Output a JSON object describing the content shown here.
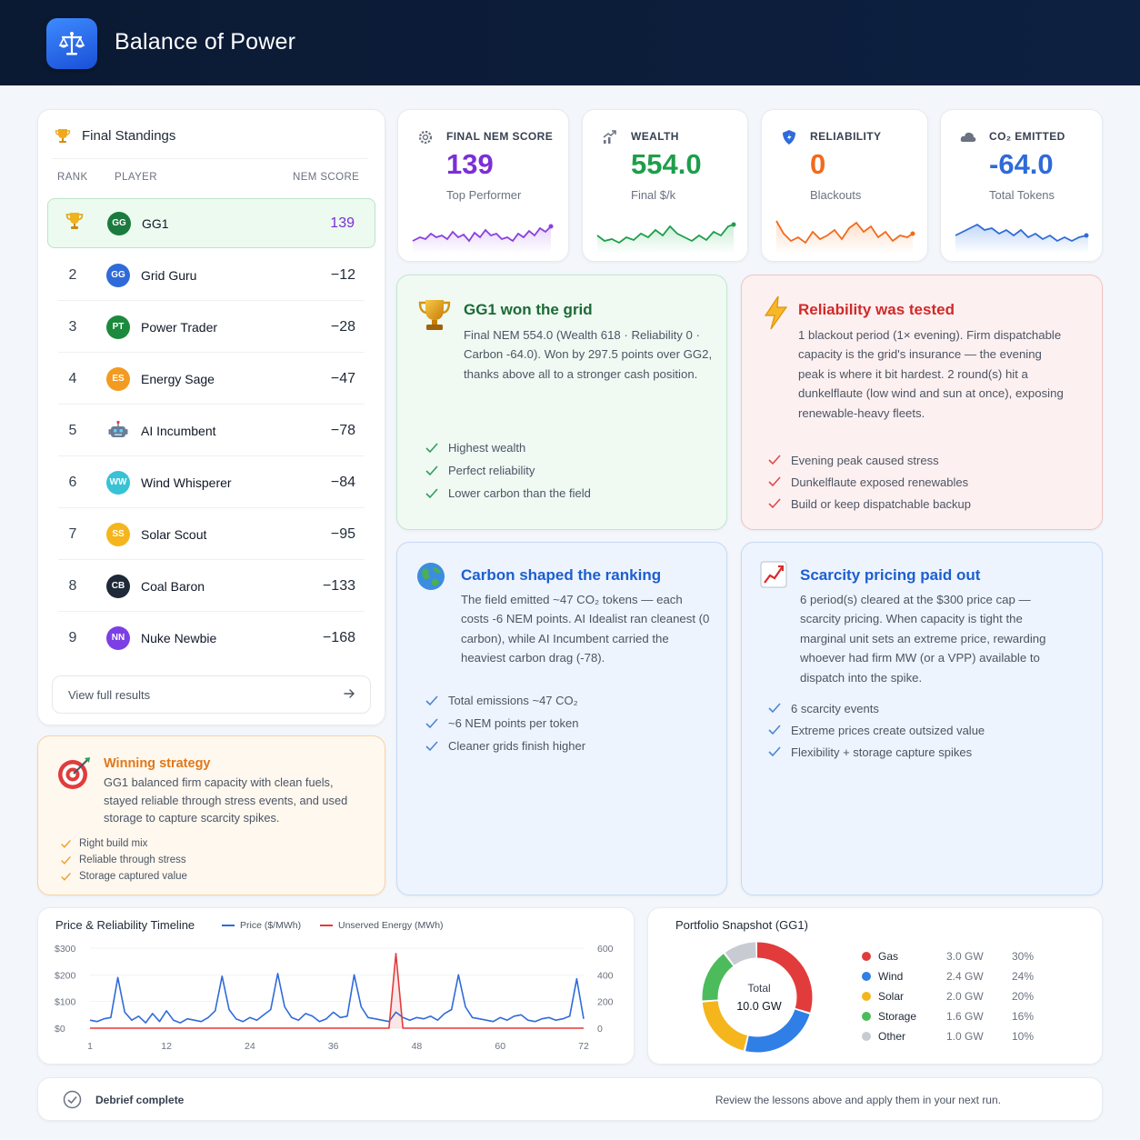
{
  "app": {
    "title": "Balance of Power",
    "logo_icon": "scale-icon"
  },
  "standings": {
    "title": "Final Standings",
    "col_rank": "RANK",
    "col_player": "PLAYER",
    "col_score": "NEM SCORE",
    "rows": [
      {
        "rank": "",
        "initials": "GG",
        "name": "GG1",
        "score": "139",
        "color": "#1b7a3e"
      },
      {
        "rank": "2",
        "initials": "GG",
        "name": "Grid Guru",
        "score": "−12",
        "color": "#2f6bd8"
      },
      {
        "rank": "3",
        "initials": "PT",
        "name": "Power Trader",
        "score": "−28",
        "color": "#1b8a3c"
      },
      {
        "rank": "4",
        "initials": "ES",
        "name": "Energy Sage",
        "score": "−47",
        "color": "#f29b20"
      },
      {
        "rank": "5",
        "initials": "",
        "name": "AI Incumbent",
        "score": "−78",
        "color": "#6b7d96"
      },
      {
        "rank": "6",
        "initials": "WW",
        "name": "Wind Whisperer",
        "score": "−84",
        "color": "#37c2d6"
      },
      {
        "rank": "7",
        "initials": "SS",
        "name": "Solar Scout",
        "score": "−95",
        "color": "#f5b51c"
      },
      {
        "rank": "8",
        "initials": "CB",
        "name": "Coal Baron",
        "score": "−133",
        "color": "#1f2937"
      },
      {
        "rank": "9",
        "initials": "NN",
        "name": "Nuke Newbie",
        "score": "−168",
        "color": "#7b3fe4"
      }
    ],
    "view_all": "View full results"
  },
  "stats": [
    {
      "label": "FINAL NEM SCORE",
      "value": "139",
      "sub": "Top Performer",
      "color": "#7b2fd6",
      "icon": "gear-icon"
    },
    {
      "label": "WEALTH",
      "value": "554.0",
      "sub": "Final $/k",
      "color": "#1e9e4b",
      "icon": "growth-icon"
    },
    {
      "label": "RELIABILITY",
      "value": "0",
      "sub": "Blackouts",
      "color": "#f26a1b",
      "icon": "shield-icon"
    },
    {
      "label": "CO₂ EMITTED",
      "value": "-64.0",
      "sub": "Total Tokens",
      "color": "#2f6bd8",
      "icon": "cloud-icon"
    }
  ],
  "insights": {
    "won": {
      "title": "GG1 won the grid",
      "body": "Final NEM 554.0 (Wealth 618 · Reliability 0 · Carbon -64.0). Won by 297.5 points over GG2, thanks above all to a stronger cash position.",
      "checks": [
        "Highest wealth",
        "Perfect reliability",
        "Lower carbon than the field"
      ]
    },
    "reliability": {
      "title": "Reliability was tested",
      "body": "1 blackout period (1× evening). Firm dispatchable capacity is the grid's insurance — the evening peak is where it bit hardest. 2 round(s) hit a dunkelflaute (low wind and sun at once), exposing renewable-heavy fleets.",
      "checks": [
        "Evening peak caused stress",
        "Dunkelflaute exposed renewables",
        "Build or keep dispatchable backup"
      ]
    },
    "carbon": {
      "title": "Carbon shaped the ranking",
      "body": "The field emitted ~47 CO₂ tokens — each costs -6 NEM points. AI Idealist ran cleanest (0 carbon), while AI Incumbent carried the heaviest carbon drag (-78).",
      "checks": [
        "Total emissions ~47 CO₂",
        "~6 NEM points per token",
        "Cleaner grids finish higher"
      ]
    },
    "scarcity": {
      "title": "Scarcity pricing paid out",
      "body": "6 period(s) cleared at the $300 price cap — scarcity pricing. When capacity is tight the marginal unit sets an extreme price, rewarding whoever had firm MW (or a VPP) available to dispatch into the spike.",
      "checks": [
        "6 scarcity events",
        "Extreme prices create outsized value",
        "Flexibility + storage capture spikes"
      ]
    },
    "strategy": {
      "title": "Winning strategy",
      "body": "GG1 balanced firm capacity with clean fuels, stayed reliable through stress events, and used storage to capture scarcity spikes.",
      "checks": [
        "Right build mix",
        "Reliable through stress",
        "Storage captured value"
      ]
    }
  },
  "timeline": {
    "title": "Price & Reliability Timeline",
    "legend_price": "Price ($/MWh)",
    "legend_unserved": "Unserved Energy (MWh)",
    "left_ticks": [
      "$300",
      "$200",
      "$100",
      "$0"
    ],
    "right_ticks": [
      "600",
      "400",
      "200",
      "0"
    ],
    "x_ticks": [
      "1",
      "12",
      "24",
      "36",
      "48",
      "60",
      "72"
    ]
  },
  "chart_data": {
    "type": "line",
    "title": "Price & Reliability Timeline",
    "x_range": [
      1,
      72
    ],
    "series": [
      {
        "name": "Price ($/MWh)",
        "axis": "left",
        "ylim": [
          0,
          300
        ],
        "color": "#2f6bd8",
        "x": [
          1,
          2,
          3,
          4,
          5,
          6,
          7,
          8,
          9,
          10,
          11,
          12,
          13,
          14,
          15,
          16,
          17,
          18,
          19,
          20,
          21,
          22,
          23,
          24,
          25,
          26,
          27,
          28,
          29,
          30,
          31,
          32,
          33,
          34,
          35,
          36,
          37,
          38,
          39,
          40,
          41,
          42,
          43,
          44,
          45,
          46,
          47,
          48,
          49,
          50,
          51,
          52,
          53,
          54,
          55,
          56,
          57,
          58,
          59,
          60,
          61,
          62,
          63,
          64,
          65,
          66,
          67,
          68,
          69,
          70,
          71,
          72
        ],
        "y": [
          30,
          25,
          35,
          40,
          190,
          60,
          30,
          45,
          20,
          55,
          25,
          65,
          30,
          20,
          35,
          30,
          25,
          40,
          65,
          195,
          70,
          35,
          25,
          40,
          30,
          50,
          70,
          205,
          80,
          40,
          30,
          55,
          45,
          25,
          35,
          60,
          40,
          45,
          200,
          80,
          40,
          35,
          30,
          25,
          60,
          40,
          30,
          40,
          35,
          45,
          30,
          55,
          70,
          200,
          80,
          40,
          35,
          30,
          25,
          40,
          30,
          45,
          50,
          30,
          25,
          35,
          40,
          30,
          35,
          45,
          185,
          35
        ]
      },
      {
        "name": "Unserved Energy (MWh)",
        "axis": "right",
        "ylim": [
          0,
          600
        ],
        "color": "#e23b3b",
        "x": [
          1,
          10,
          20,
          30,
          40,
          44,
          45,
          46,
          47,
          50,
          60,
          72
        ],
        "y": [
          0,
          0,
          0,
          0,
          0,
          0,
          560,
          0,
          0,
          0,
          0,
          0
        ]
      }
    ]
  },
  "portfolio": {
    "title": "Portfolio Snapshot (GG1)",
    "center_label": "Total",
    "center_value": "10.0 GW",
    "items": [
      {
        "name": "Gas",
        "gw": "3.0 GW",
        "pct": "30%",
        "share": 30,
        "color": "#e23b3b"
      },
      {
        "name": "Wind",
        "gw": "2.4 GW",
        "pct": "24%",
        "share": 24,
        "color": "#2f7fe6"
      },
      {
        "name": "Solar",
        "gw": "2.0 GW",
        "pct": "20%",
        "share": 20,
        "color": "#f5b51c"
      },
      {
        "name": "Storage",
        "gw": "1.6 GW",
        "pct": "16%",
        "share": 16,
        "color": "#4cbb5c"
      },
      {
        "name": "Other",
        "gw": "1.0 GW",
        "pct": "10%",
        "share": 10,
        "color": "#c8ccd2"
      }
    ]
  },
  "footer": {
    "status": "Debrief complete",
    "hint": "Review the lessons above and apply them in your next run."
  }
}
